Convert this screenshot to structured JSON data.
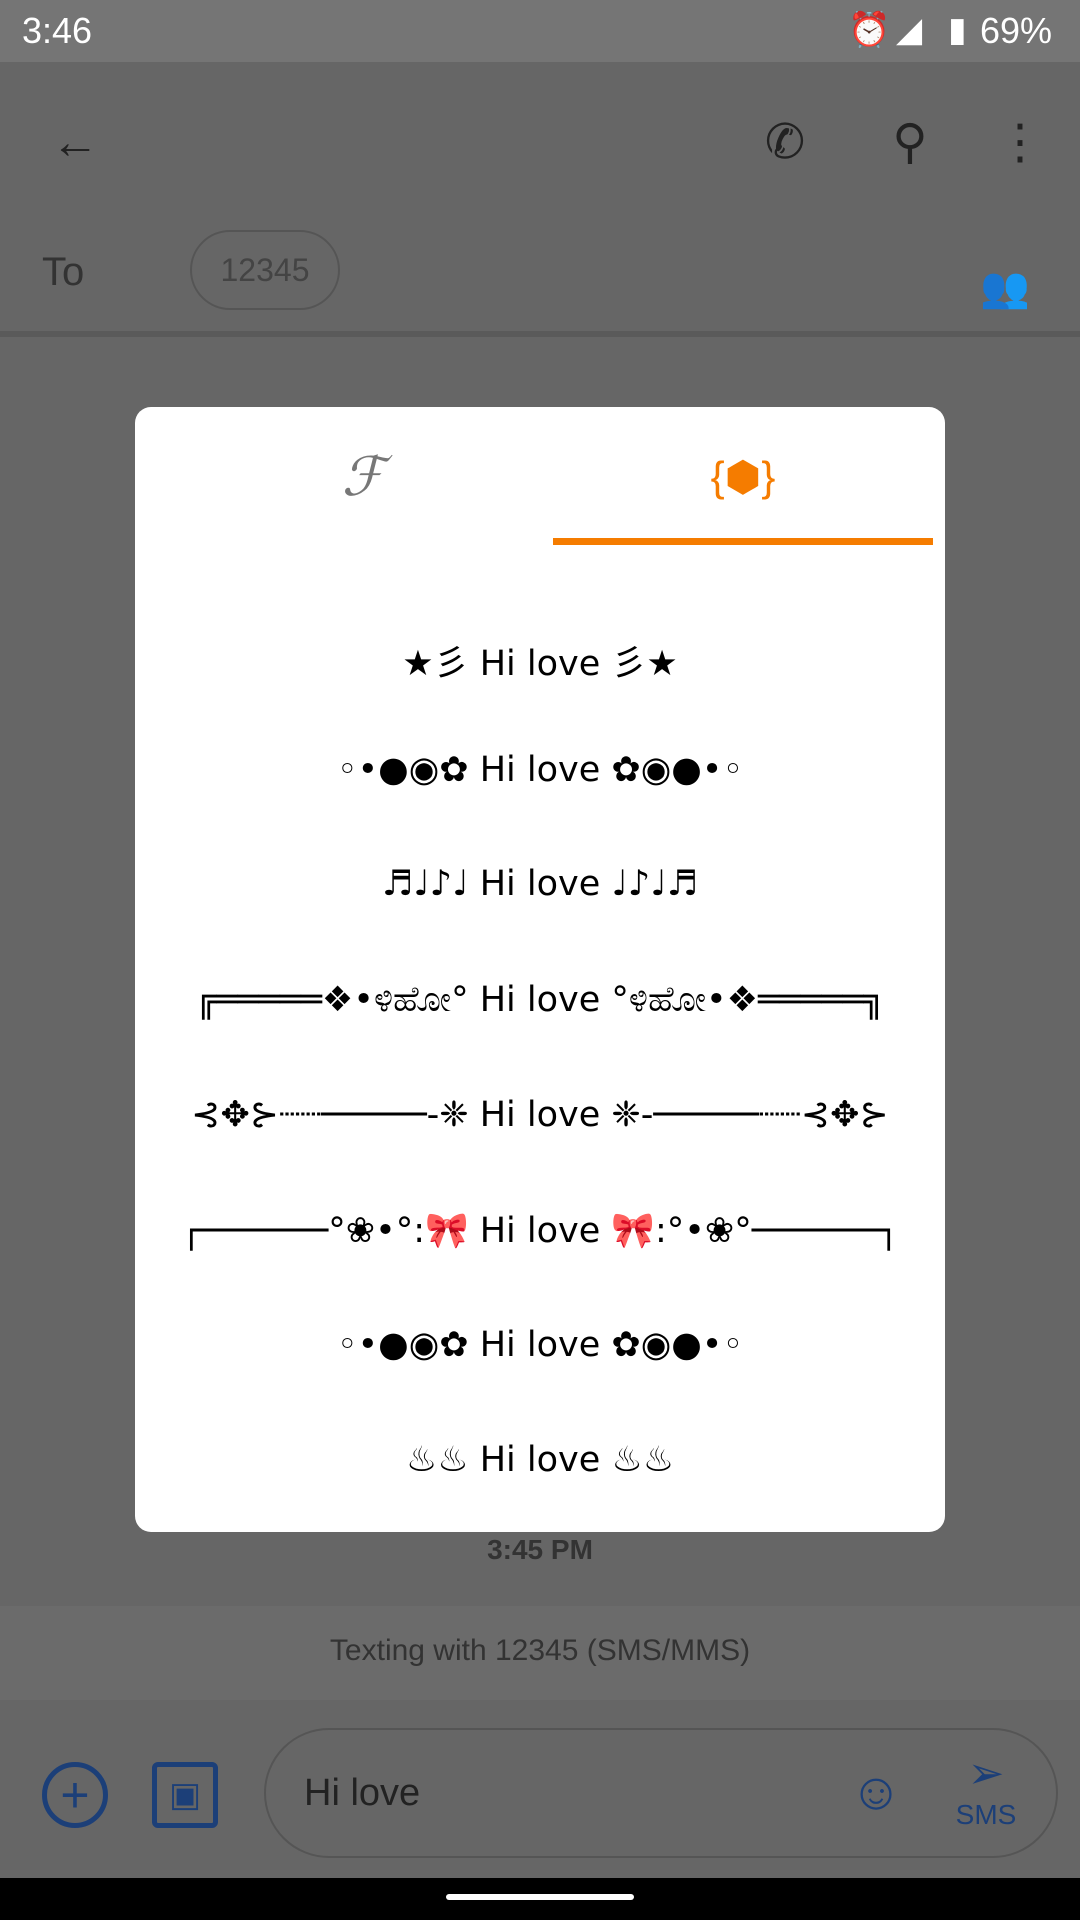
{
  "status_bar": {
    "time": "3:46",
    "battery": "69%",
    "icons": [
      "alarm-icon",
      "signal-off-icon",
      "battery-icon"
    ]
  },
  "app_bar": {
    "icons": [
      "back-arrow-icon",
      "phone-icon",
      "search-icon",
      "more-vert-icon"
    ],
    "to_label": "To",
    "recipient": "12345",
    "add_contact_icon": "group-add-icon"
  },
  "dialog": {
    "tabs": [
      {
        "label": "ℱ",
        "icon": "font-icon",
        "selected": false
      },
      {
        "label": "{⬢}",
        "icon": "decoration-icon",
        "selected": true
      }
    ],
    "accent": "#f57c00",
    "items": [
      "★彡 Hi love 彡★",
      "◦•●◉✿ Hi love ✿◉●•◦",
      "♬♩♪♩ Hi love ♩♪♩♬",
      "╔═════❖•ಳಿಹೋ° Hi love °ಳಿಹೋ•❖═════╗",
      "⊰✥⊱┈┈─────-❈ Hi love ❈-─────┈┈⊰✥⊱",
      "┌──────°❀•°:🎀 Hi love 🎀:°•❀°──────┐",
      "◦•●◉✿ Hi love ✿◉●•◦",
      "♨♨ Hi love ♨♨"
    ]
  },
  "conversation": {
    "timestamp": "3:45 PM",
    "texting_info": "Texting with 12345 (SMS/MMS)"
  },
  "composer": {
    "message": "Hi love",
    "send_label": "SMS",
    "icons": [
      "add-circle-icon",
      "gallery-icon",
      "emoji-icon",
      "send-icon"
    ]
  }
}
